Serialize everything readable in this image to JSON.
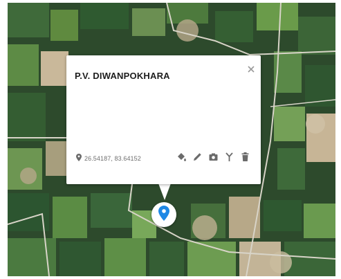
{
  "popup": {
    "title": "P.V. DIWANPOKHARA",
    "coordinates": "26.54187, 83.64152",
    "close_icon": "close-icon",
    "coordinate_icon": "location-pin-icon",
    "tools": [
      {
        "name": "fill-color-icon"
      },
      {
        "name": "edit-pencil-icon"
      },
      {
        "name": "camera-icon"
      },
      {
        "name": "route-fork-icon"
      },
      {
        "name": "delete-trash-icon"
      }
    ]
  },
  "marker": {
    "icon": "map-pin-icon",
    "color": "#1e88e5"
  },
  "colors": {
    "icon_gray": "#6b6b6b",
    "map_base": "#2d4a2c"
  }
}
